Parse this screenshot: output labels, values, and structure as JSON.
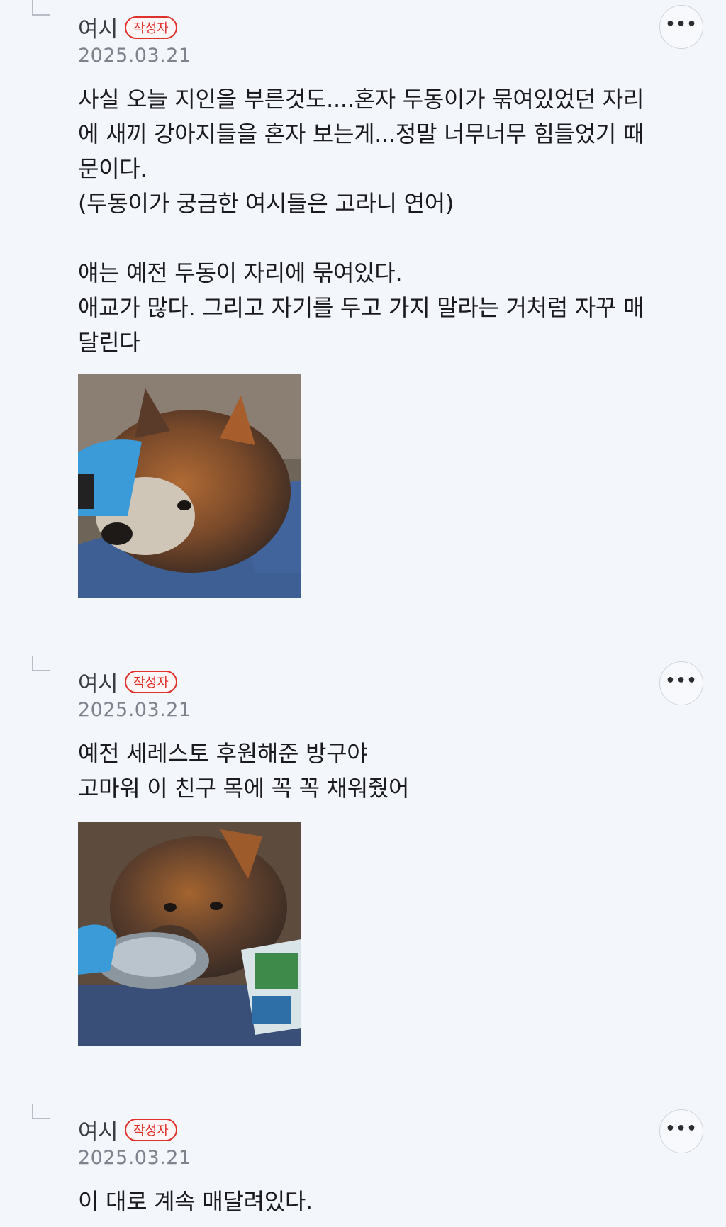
{
  "comments": [
    {
      "author": "여시",
      "badge": "작성자",
      "date": "2025.03.21",
      "more_icon": "ellipsis-icon",
      "text": "사실 오늘 지인을 부른것도....혼자 두동이가 묶여있었던 자리\n에 새끼 강아지들을 혼자 보는게...정말 너무너무 힘들었기 때\n문이다.\n(두동이가 궁금한 여시들은 고라니 연어)\n\n얘는 예전 두동이 자리에 묶여있다.\n애교가 많다. 그리고 자기를 두고 가지 말라는 거처럼 자꾸 매\n달린다",
      "has_photo": true
    },
    {
      "author": "여시",
      "badge": "작성자",
      "date": "2025.03.21",
      "more_icon": "ellipsis-icon",
      "text": "예전 세레스토 후원해준 방구야\n고마워 이 친구 목에 꼭 꼭 채워줬어",
      "has_photo": true
    },
    {
      "author": "여시",
      "badge": "작성자",
      "date": "2025.03.21",
      "more_icon": "ellipsis-icon",
      "text": "이 대로 계속 매달려있다.",
      "has_photo": false
    }
  ],
  "colors": {
    "background": "#f3f6fa",
    "badge_red": "#e0322c",
    "meta_gray": "#7d828c",
    "divider": "#dfe3ea"
  }
}
